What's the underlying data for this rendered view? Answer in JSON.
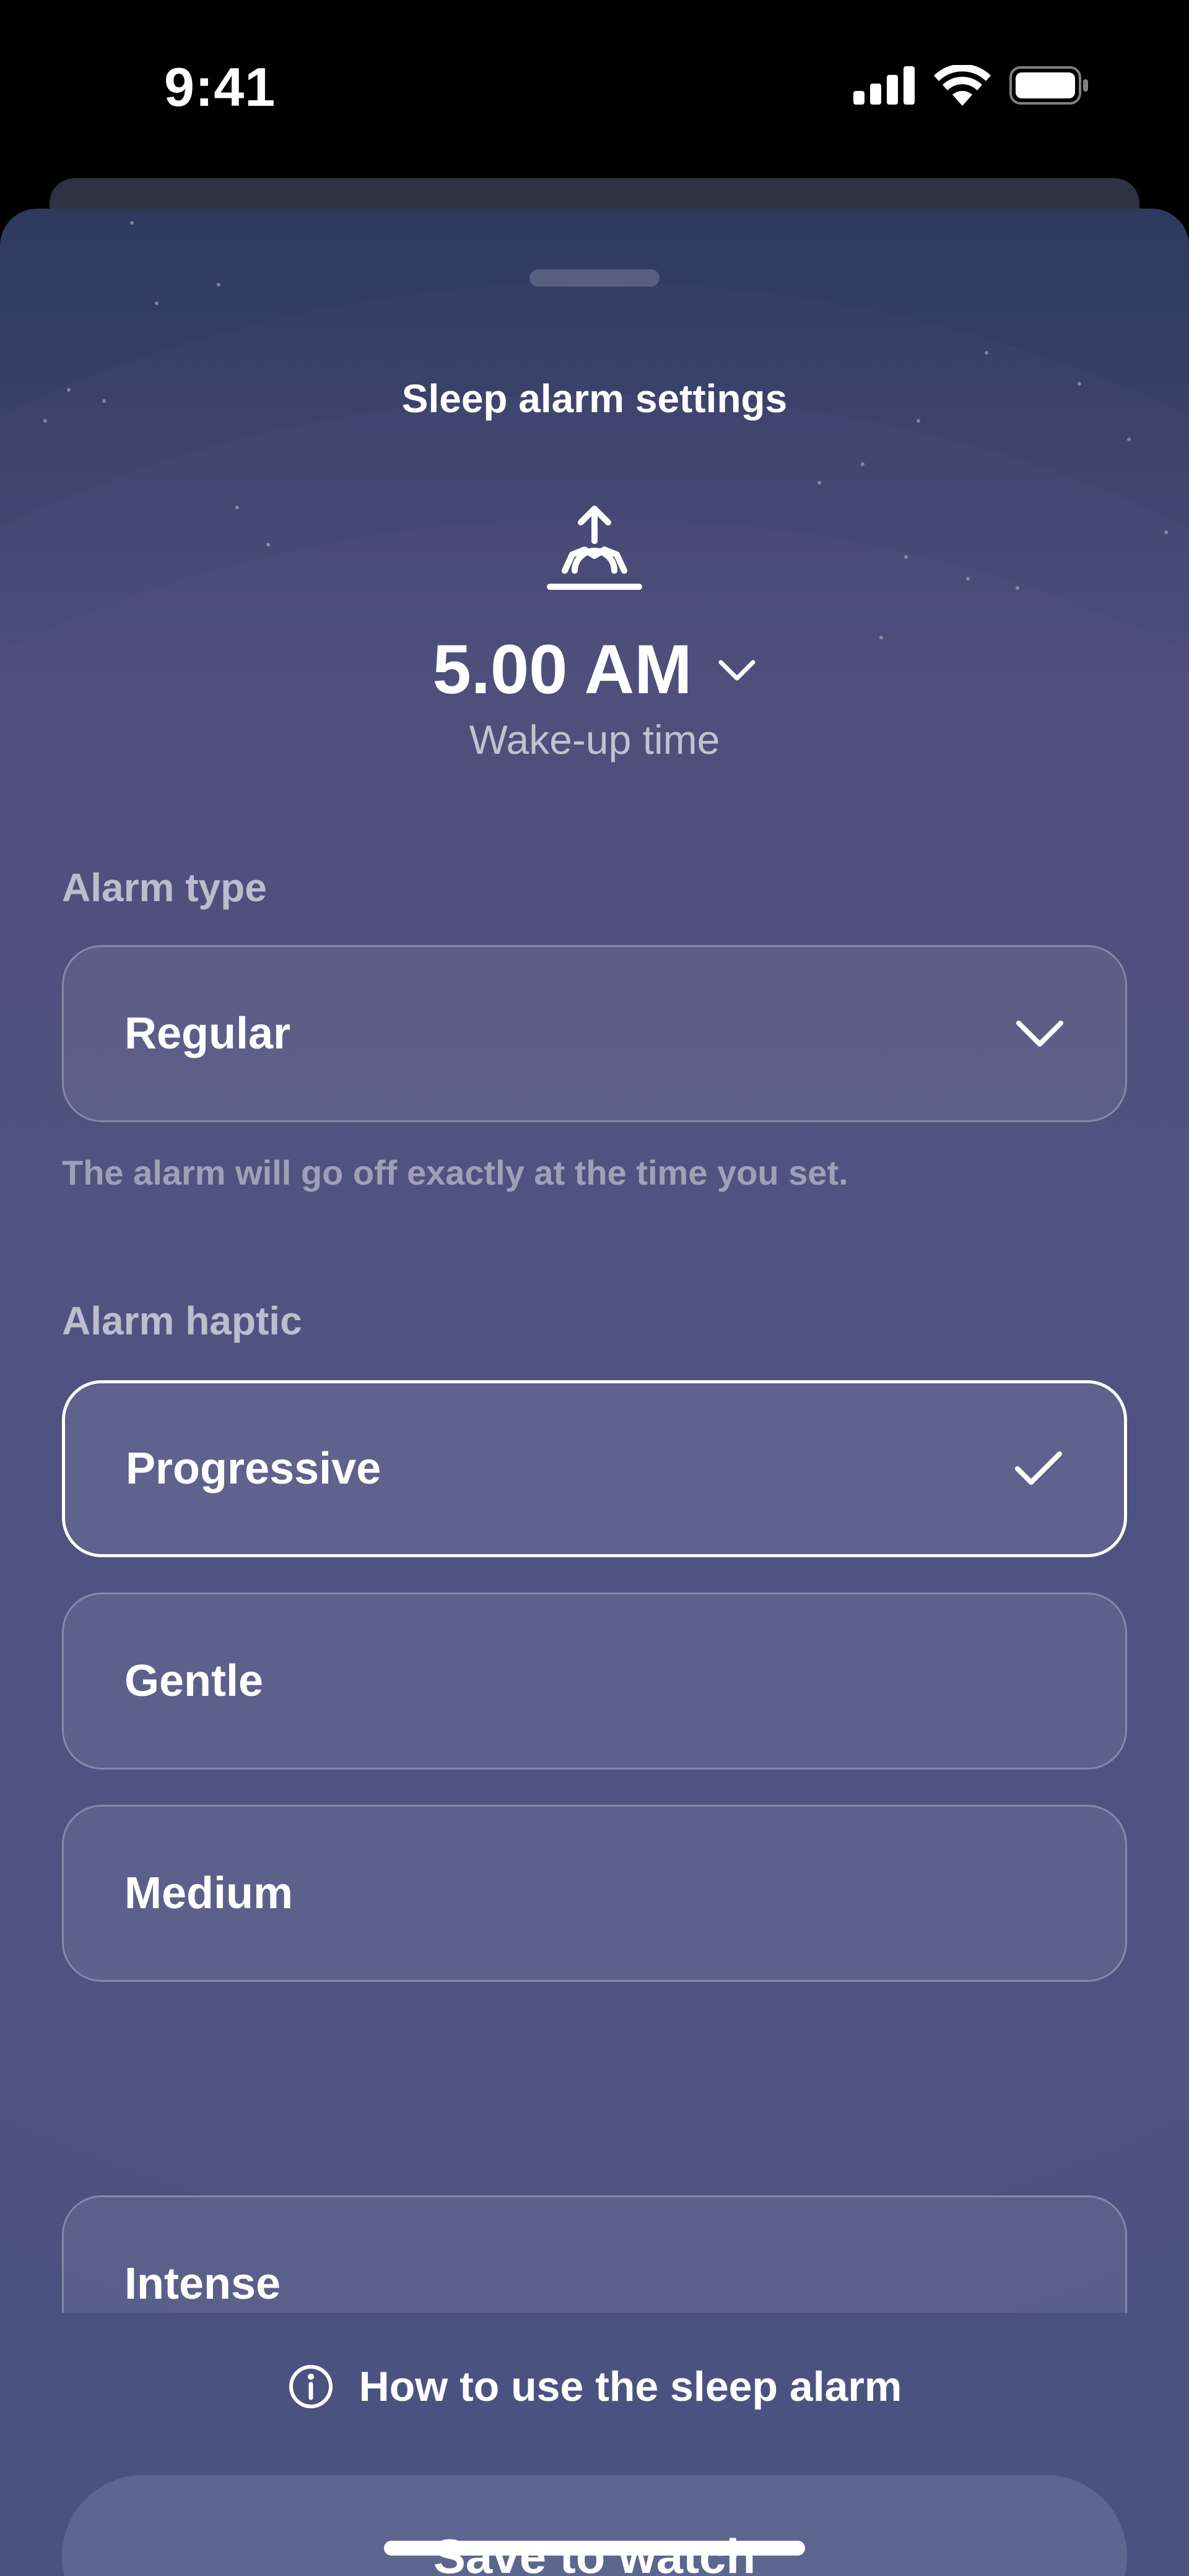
{
  "status_bar": {
    "time": "9:41"
  },
  "sheet": {
    "title": "Sleep alarm settings",
    "wake_time": "5.00 AM",
    "wake_label": "Wake-up time"
  },
  "alarm_type": {
    "label": "Alarm type",
    "selected": "Regular",
    "hint": "The alarm will go off exactly at the time you set."
  },
  "alarm_haptic": {
    "label": "Alarm haptic",
    "options": [
      {
        "label": "Progressive",
        "selected": true
      },
      {
        "label": "Gentle",
        "selected": false
      },
      {
        "label": "Medium",
        "selected": false
      },
      {
        "label": "Intense",
        "selected": false
      }
    ]
  },
  "footer": {
    "help_link": "How to use the sleep alarm",
    "save_button": "Save to watch"
  },
  "icons": {
    "signal": "cellular-signal-icon",
    "wifi": "wifi-icon",
    "battery": "battery-icon",
    "wake": "sunrise-icon",
    "chevron": "chevron-down-icon",
    "check": "checkmark-icon",
    "info": "info-icon"
  },
  "colors": {
    "sheet_bg": "#4a5380",
    "button_bg": "#5d668f",
    "text": "#ffffff"
  }
}
